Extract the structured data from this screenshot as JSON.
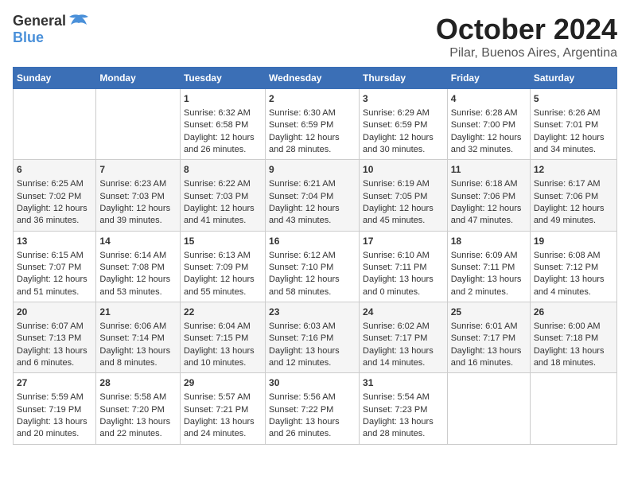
{
  "logo": {
    "general": "General",
    "blue": "Blue"
  },
  "title": "October 2024",
  "subtitle": "Pilar, Buenos Aires, Argentina",
  "days_of_week": [
    "Sunday",
    "Monday",
    "Tuesday",
    "Wednesday",
    "Thursday",
    "Friday",
    "Saturday"
  ],
  "weeks": [
    [
      {
        "day": "",
        "content": ""
      },
      {
        "day": "",
        "content": ""
      },
      {
        "day": "1",
        "content": "Sunrise: 6:32 AM\nSunset: 6:58 PM\nDaylight: 12 hours and 26 minutes."
      },
      {
        "day": "2",
        "content": "Sunrise: 6:30 AM\nSunset: 6:59 PM\nDaylight: 12 hours and 28 minutes."
      },
      {
        "day": "3",
        "content": "Sunrise: 6:29 AM\nSunset: 6:59 PM\nDaylight: 12 hours and 30 minutes."
      },
      {
        "day": "4",
        "content": "Sunrise: 6:28 AM\nSunset: 7:00 PM\nDaylight: 12 hours and 32 minutes."
      },
      {
        "day": "5",
        "content": "Sunrise: 6:26 AM\nSunset: 7:01 PM\nDaylight: 12 hours and 34 minutes."
      }
    ],
    [
      {
        "day": "6",
        "content": "Sunrise: 6:25 AM\nSunset: 7:02 PM\nDaylight: 12 hours and 36 minutes."
      },
      {
        "day": "7",
        "content": "Sunrise: 6:23 AM\nSunset: 7:03 PM\nDaylight: 12 hours and 39 minutes."
      },
      {
        "day": "8",
        "content": "Sunrise: 6:22 AM\nSunset: 7:03 PM\nDaylight: 12 hours and 41 minutes."
      },
      {
        "day": "9",
        "content": "Sunrise: 6:21 AM\nSunset: 7:04 PM\nDaylight: 12 hours and 43 minutes."
      },
      {
        "day": "10",
        "content": "Sunrise: 6:19 AM\nSunset: 7:05 PM\nDaylight: 12 hours and 45 minutes."
      },
      {
        "day": "11",
        "content": "Sunrise: 6:18 AM\nSunset: 7:06 PM\nDaylight: 12 hours and 47 minutes."
      },
      {
        "day": "12",
        "content": "Sunrise: 6:17 AM\nSunset: 7:06 PM\nDaylight: 12 hours and 49 minutes."
      }
    ],
    [
      {
        "day": "13",
        "content": "Sunrise: 6:15 AM\nSunset: 7:07 PM\nDaylight: 12 hours and 51 minutes."
      },
      {
        "day": "14",
        "content": "Sunrise: 6:14 AM\nSunset: 7:08 PM\nDaylight: 12 hours and 53 minutes."
      },
      {
        "day": "15",
        "content": "Sunrise: 6:13 AM\nSunset: 7:09 PM\nDaylight: 12 hours and 55 minutes."
      },
      {
        "day": "16",
        "content": "Sunrise: 6:12 AM\nSunset: 7:10 PM\nDaylight: 12 hours and 58 minutes."
      },
      {
        "day": "17",
        "content": "Sunrise: 6:10 AM\nSunset: 7:11 PM\nDaylight: 13 hours and 0 minutes."
      },
      {
        "day": "18",
        "content": "Sunrise: 6:09 AM\nSunset: 7:11 PM\nDaylight: 13 hours and 2 minutes."
      },
      {
        "day": "19",
        "content": "Sunrise: 6:08 AM\nSunset: 7:12 PM\nDaylight: 13 hours and 4 minutes."
      }
    ],
    [
      {
        "day": "20",
        "content": "Sunrise: 6:07 AM\nSunset: 7:13 PM\nDaylight: 13 hours and 6 minutes."
      },
      {
        "day": "21",
        "content": "Sunrise: 6:06 AM\nSunset: 7:14 PM\nDaylight: 13 hours and 8 minutes."
      },
      {
        "day": "22",
        "content": "Sunrise: 6:04 AM\nSunset: 7:15 PM\nDaylight: 13 hours and 10 minutes."
      },
      {
        "day": "23",
        "content": "Sunrise: 6:03 AM\nSunset: 7:16 PM\nDaylight: 13 hours and 12 minutes."
      },
      {
        "day": "24",
        "content": "Sunrise: 6:02 AM\nSunset: 7:17 PM\nDaylight: 13 hours and 14 minutes."
      },
      {
        "day": "25",
        "content": "Sunrise: 6:01 AM\nSunset: 7:17 PM\nDaylight: 13 hours and 16 minutes."
      },
      {
        "day": "26",
        "content": "Sunrise: 6:00 AM\nSunset: 7:18 PM\nDaylight: 13 hours and 18 minutes."
      }
    ],
    [
      {
        "day": "27",
        "content": "Sunrise: 5:59 AM\nSunset: 7:19 PM\nDaylight: 13 hours and 20 minutes."
      },
      {
        "day": "28",
        "content": "Sunrise: 5:58 AM\nSunset: 7:20 PM\nDaylight: 13 hours and 22 minutes."
      },
      {
        "day": "29",
        "content": "Sunrise: 5:57 AM\nSunset: 7:21 PM\nDaylight: 13 hours and 24 minutes."
      },
      {
        "day": "30",
        "content": "Sunrise: 5:56 AM\nSunset: 7:22 PM\nDaylight: 13 hours and 26 minutes."
      },
      {
        "day": "31",
        "content": "Sunrise: 5:54 AM\nSunset: 7:23 PM\nDaylight: 13 hours and 28 minutes."
      },
      {
        "day": "",
        "content": ""
      },
      {
        "day": "",
        "content": ""
      }
    ]
  ]
}
